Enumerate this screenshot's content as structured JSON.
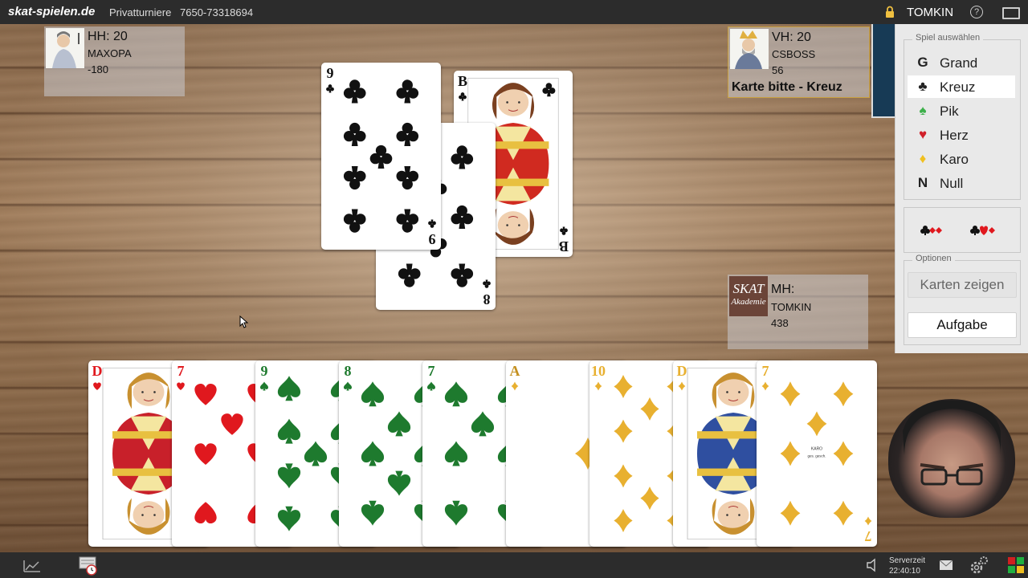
{
  "topbar": {
    "brand": "skat-spielen.de",
    "tournament": "Privatturniere",
    "game_id": "7650-73318694",
    "username": "TOMKIN",
    "help_icon": "help-icon",
    "window_icon": "window-toggle-icon"
  },
  "players": {
    "left": {
      "role": "HH: 20",
      "name": "MAXOPA",
      "score": "-180"
    },
    "right": {
      "role": "VH: 20",
      "name": "CSBOSS",
      "score": "56",
      "request": "Karte bitte - Kreuz"
    },
    "self": {
      "role": "MH:",
      "name": "TOMKIN",
      "score": "438",
      "avatar_text1": "SKAT",
      "avatar_text2": "Akademie"
    }
  },
  "trick": [
    {
      "rank": "9",
      "suit": "clubs"
    },
    {
      "rank": "B",
      "suit": "clubs"
    },
    {
      "rank": "8",
      "suit": "clubs"
    }
  ],
  "hand": [
    {
      "rank": "D",
      "suit": "hearts"
    },
    {
      "rank": "7",
      "suit": "hearts"
    },
    {
      "rank": "9",
      "suit": "spades"
    },
    {
      "rank": "8",
      "suit": "spades"
    },
    {
      "rank": "7",
      "suit": "spades"
    },
    {
      "rank": "A",
      "suit": "diamonds"
    },
    {
      "rank": "10",
      "suit": "diamonds"
    },
    {
      "rank": "D",
      "suit": "diamonds"
    },
    {
      "rank": "7",
      "suit": "diamonds"
    }
  ],
  "seven_diamond_text": [
    "KARO",
    "ges. gesch."
  ],
  "panel": {
    "game_select_title": "Spiel auswählen",
    "games": [
      {
        "symbol": "G",
        "label": "Grand",
        "color": "#222222"
      },
      {
        "symbol": "♣",
        "label": "Kreuz",
        "color": "#222222"
      },
      {
        "symbol": "♠",
        "label": "Pik",
        "color": "#3cb04a"
      },
      {
        "symbol": "♥",
        "label": "Herz",
        "color": "#d0202a"
      },
      {
        "symbol": "♦",
        "label": "Karo",
        "color": "#f0c020"
      },
      {
        "symbol": "N",
        "label": "Null",
        "color": "#222222"
      }
    ],
    "selected_game": "Kreuz",
    "options_title": "Optionen",
    "show_cards": "Karten zeigen",
    "give_up": "Aufgabe"
  },
  "bottombar": {
    "server_label": "Serverzeit",
    "server_time": "22:40:10"
  },
  "colors": {
    "hearts": "#e0181e",
    "diamonds": "#e8b030",
    "spades": "#1e7a2e",
    "clubs": "#111111"
  }
}
